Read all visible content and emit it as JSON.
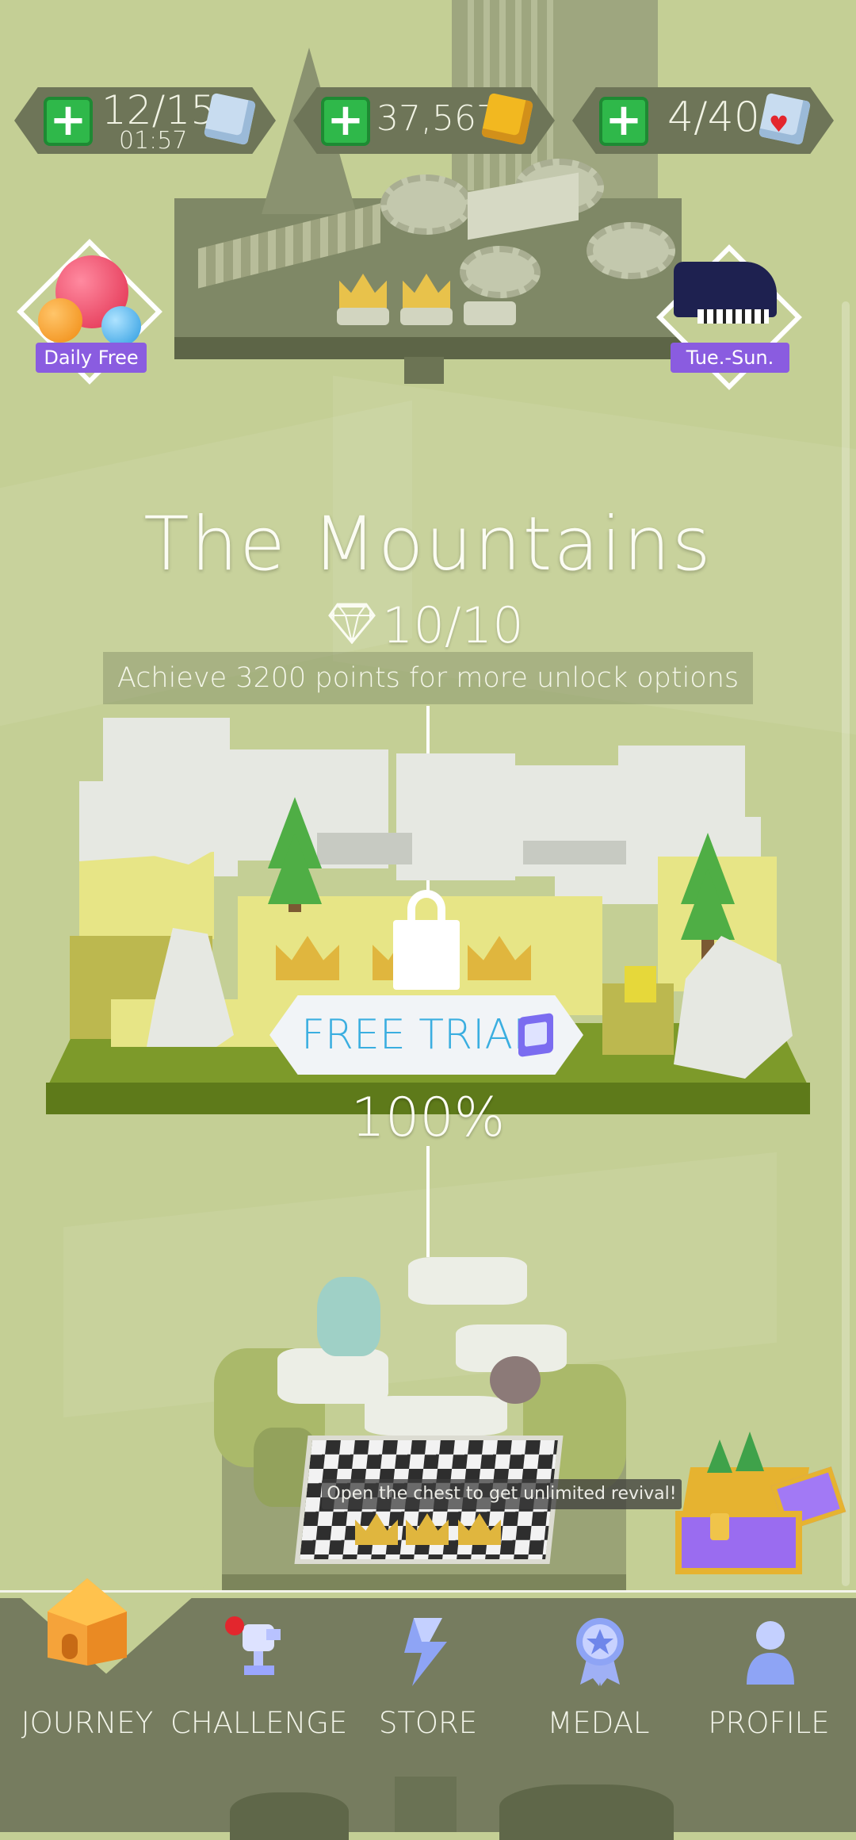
{
  "hud": {
    "lives": {
      "value": "12/15",
      "timer": "01:57",
      "icon": "blue-cube-icon"
    },
    "coins": {
      "value": "37,567",
      "icon": "gold-cube-icon"
    },
    "hearts": {
      "value": "4/40",
      "icon": "heart-cube-icon"
    },
    "add_icon": "plus-icon"
  },
  "badges": {
    "left": {
      "label": "Daily Free",
      "icon": "gems-icon"
    },
    "right": {
      "label": "Tue.-Sun.",
      "icon": "piano-icon"
    }
  },
  "level": {
    "title": "The Mountains",
    "gems": "10/10",
    "gem_icon": "diamond-outline-icon",
    "hint": "Achieve 3200 points for more unlock options",
    "trial_button": "FREE TRIAL",
    "trial_icon": "video-ad-icon",
    "lock_icon": "padlock-icon",
    "progress": "100%"
  },
  "next_level": {
    "chest_tooltip": "Open the chest to get unlimited revival!"
  },
  "nav": {
    "items": [
      {
        "label": "JOURNEY",
        "icon": "home-icon",
        "active": true
      },
      {
        "label": "CHALLENGE",
        "icon": "trophy-icon",
        "notification": true
      },
      {
        "label": "STORE",
        "icon": "store-icon"
      },
      {
        "label": "MEDAL",
        "icon": "medal-icon"
      },
      {
        "label": "PROFILE",
        "icon": "profile-icon"
      }
    ]
  },
  "colors": {
    "background": "#c4cf95",
    "nav_bar": "#767c5f",
    "plus_green": "#2fb84a",
    "trial_text": "#3aaee0",
    "badge_purple": "#8a5ce0",
    "notification_red": "#e3262d"
  }
}
